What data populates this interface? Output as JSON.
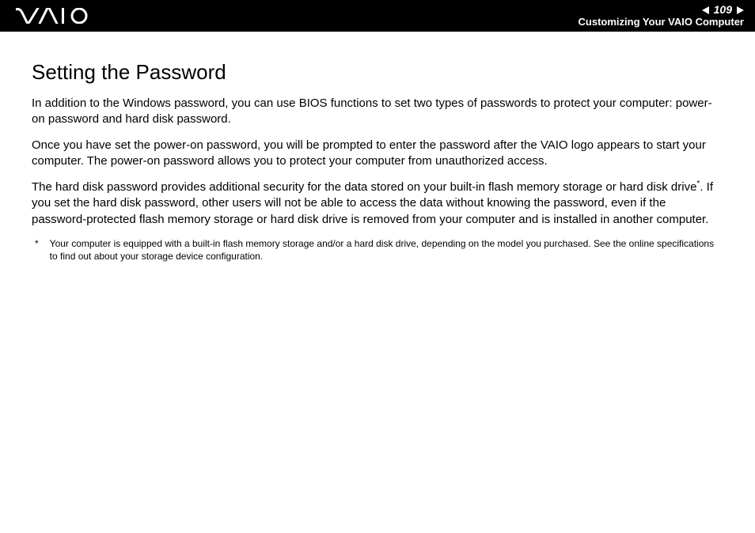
{
  "header": {
    "page_number": "109",
    "section_label": "Customizing Your VAIO Computer"
  },
  "content": {
    "title": "Setting the Password",
    "paragraphs": [
      "In addition to the Windows password, you can use BIOS functions to set two types of passwords to protect your computer: power-on password and hard disk password.",
      "Once you have set the power-on password, you will be prompted to enter the password after the VAIO logo appears to start your computer. The power-on password allows you to protect your computer from unauthorized access."
    ],
    "para3_before": "The hard disk password provides additional security for the data stored on your built-in flash memory storage or hard disk drive",
    "para3_sup": "*",
    "para3_after": ". If you set the hard disk password, other users will not be able to access the data without knowing the password, even if the password-protected flash memory storage or hard disk drive is removed from your computer and is installed in another computer.",
    "footnote_marker": "*",
    "footnote_text": "Your computer is equipped with a built-in flash memory storage and/or a hard disk drive, depending on the model you purchased. See the online specifications to find out about your storage device configuration."
  }
}
